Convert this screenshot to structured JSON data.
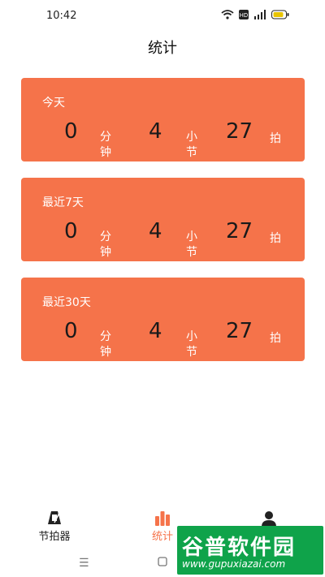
{
  "status": {
    "time": "10:42"
  },
  "page": {
    "title": "统计"
  },
  "cards": [
    {
      "title": "今天",
      "minutes": "0",
      "minutes_unit": [
        "分",
        "钟"
      ],
      "bars": "4",
      "bars_unit": [
        "小",
        "节"
      ],
      "beats": "27",
      "beats_unit": "拍"
    },
    {
      "title": "最近7天",
      "minutes": "0",
      "minutes_unit": [
        "分",
        "钟"
      ],
      "bars": "4",
      "bars_unit": [
        "小",
        "节"
      ],
      "beats": "27",
      "beats_unit": "拍"
    },
    {
      "title": "最近30天",
      "minutes": "0",
      "minutes_unit": [
        "分",
        "钟"
      ],
      "bars": "4",
      "bars_unit": [
        "小",
        "节"
      ],
      "beats": "27",
      "beats_unit": "拍"
    }
  ],
  "tabs": [
    {
      "label": "节拍器",
      "icon": "metronome-icon",
      "active": false
    },
    {
      "label": "统计",
      "icon": "bar-chart-icon",
      "active": true
    },
    {
      "label": "",
      "icon": "user-icon",
      "active": false
    }
  ],
  "watermark": {
    "text": "谷普软件园",
    "url": "www.gupuxiazai.com"
  },
  "colors": {
    "accent": "#f5734a",
    "watermark": "#0fa34a"
  }
}
